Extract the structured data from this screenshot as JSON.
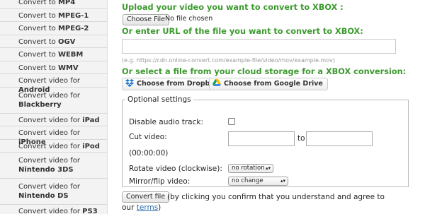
{
  "sidebar": {
    "items": [
      {
        "pre": "Convert to ",
        "fmt": "MP4",
        "tall": false
      },
      {
        "pre": "Convert to ",
        "fmt": "MPEG-1",
        "tall": false
      },
      {
        "pre": "Convert to ",
        "fmt": "MPEG-2",
        "tall": false
      },
      {
        "pre": "Convert to ",
        "fmt": "OGV",
        "tall": false
      },
      {
        "pre": "Convert to ",
        "fmt": "WEBM",
        "tall": false
      },
      {
        "pre": "Convert to ",
        "fmt": "WMV",
        "tall": false
      },
      {
        "pre": "Convert video for ",
        "fmt": "Android",
        "tall": false
      },
      {
        "pre": "Convert video for ",
        "fmt": "Blackberry",
        "tall": true
      },
      {
        "pre": "Convert video for ",
        "fmt": "iPad",
        "tall": false
      },
      {
        "pre": "Convert video for ",
        "fmt": "iPhone",
        "tall": false
      },
      {
        "pre": "Convert video for ",
        "fmt": "iPod",
        "tall": false
      },
      {
        "pre": "Convert video for ",
        "fmt": "Nintendo 3DS",
        "tall": true
      },
      {
        "pre": "Convert video for ",
        "fmt": "Nintendo DS",
        "tall": true
      },
      {
        "pre": "Convert video for ",
        "fmt": "PS3",
        "tall": false
      }
    ]
  },
  "upload": {
    "heading": "Upload your video you want to convert to XBOX :",
    "choose_file": "Choose File",
    "no_file": "No file chosen"
  },
  "url": {
    "heading": "Or enter URL of the file you want to convert to XBOX:",
    "value": "",
    "hint": "(e.g. https://cdn.online-convert.com/example-file/video/mov/example.mov)"
  },
  "cloud": {
    "heading": "Or select a file from your cloud storage for a XBOX conversion:",
    "dropbox": "Choose from Dropbox",
    "gdrive": "Choose from Google Drive"
  },
  "options": {
    "legend": "Optional settings",
    "disable_audio": "Disable audio track:",
    "cut_video": "Cut video:",
    "to": "to",
    "time_hint": "(00:00:00)",
    "rotate_label": "Rotate video (clockwise):",
    "rotate_value": "no rotation",
    "mirror_label": "Mirror/flip video:",
    "mirror_value": "no change"
  },
  "footer": {
    "convert": "Convert file",
    "agree_text": "(by clicking you confirm that you understand and agree to",
    "our": "our",
    "terms": "terms",
    "close": ")"
  },
  "colors": {
    "heading": "#3c9a2e",
    "link": "#2a6aa8",
    "sidebar_bg": "#f3f3f3"
  }
}
